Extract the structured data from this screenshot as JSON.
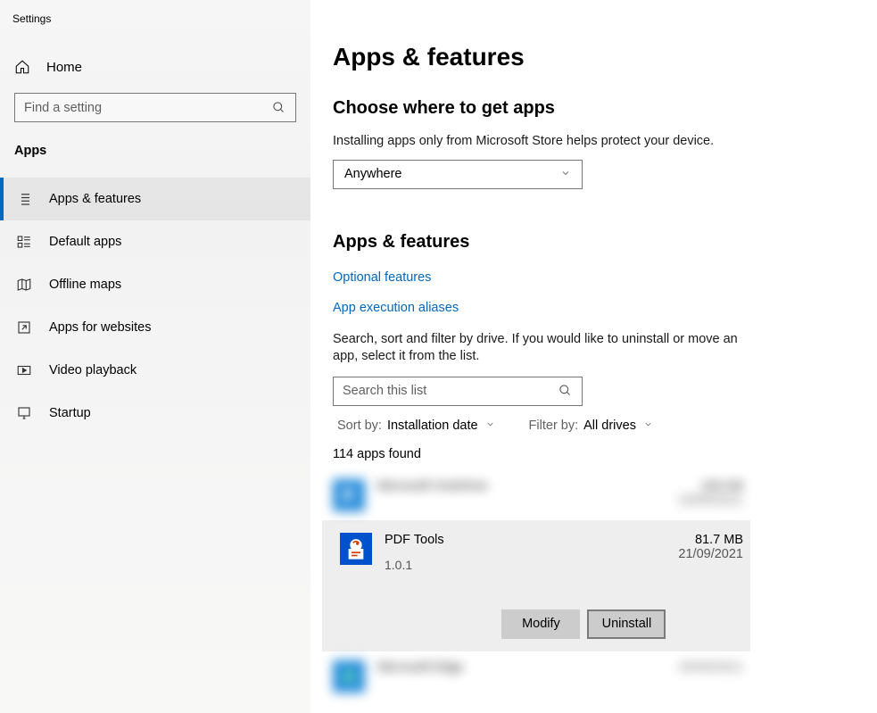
{
  "window_title": "Settings",
  "sidebar": {
    "home_label": "Home",
    "search_placeholder": "Find a setting",
    "category_label": "Apps",
    "items": [
      {
        "label": "Apps & features",
        "active": true
      },
      {
        "label": "Default apps",
        "active": false
      },
      {
        "label": "Offline maps",
        "active": false
      },
      {
        "label": "Apps for websites",
        "active": false
      },
      {
        "label": "Video playback",
        "active": false
      },
      {
        "label": "Startup",
        "active": false
      }
    ]
  },
  "main": {
    "page_title": "Apps & features",
    "source_section": {
      "heading": "Choose where to get apps",
      "description": "Installing apps only from Microsoft Store helps protect your device.",
      "dropdown_value": "Anywhere"
    },
    "features_section": {
      "heading": "Apps & features",
      "link_optional": "Optional features",
      "link_aliases": "App execution aliases",
      "description": "Search, sort and filter by drive. If you would like to uninstall or move an app, select it from the list.",
      "search_placeholder": "Search this list",
      "sort_label": "Sort by:",
      "sort_value": "Installation date",
      "filter_label": "Filter by:",
      "filter_value": "All drives",
      "count_text": "114 apps found"
    },
    "apps": {
      "blurred_top": {
        "name": "Microsoft OneDrive",
        "size": "193 KB",
        "date": "23/09/2021"
      },
      "selected": {
        "name": "PDF Tools",
        "version": "1.0.1",
        "size": "81.7 MB",
        "date": "21/09/2021",
        "btn_modify": "Modify",
        "btn_uninstall": "Uninstall"
      },
      "blurred_bottom": {
        "name": "Microsoft Edge",
        "date": "20/09/2021"
      }
    }
  }
}
